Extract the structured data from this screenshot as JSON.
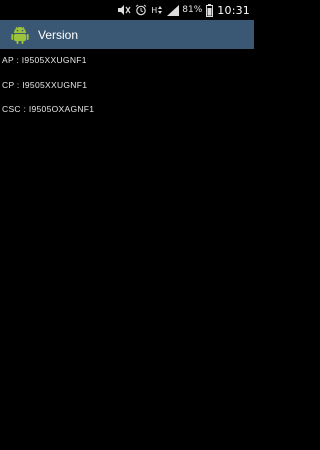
{
  "status_bar": {
    "icons": [
      "mute-icon",
      "alarm-icon",
      "signal-h-icon",
      "signal-bars-icon",
      "battery-icon"
    ],
    "network_label": "H",
    "battery_percent": "81%",
    "time": "10:31"
  },
  "action_bar": {
    "app_icon": "android-icon",
    "title": "Version"
  },
  "content": {
    "lines": [
      "AP : I9505XXUGNF1",
      "CP : I9505XXUGNF1",
      "CSC : I9505OXAGNF1"
    ]
  },
  "colors": {
    "action_bar_bg": "#3a5773",
    "background": "#000000",
    "text": "#e8e8e8",
    "android_green": "#9dc43a"
  }
}
